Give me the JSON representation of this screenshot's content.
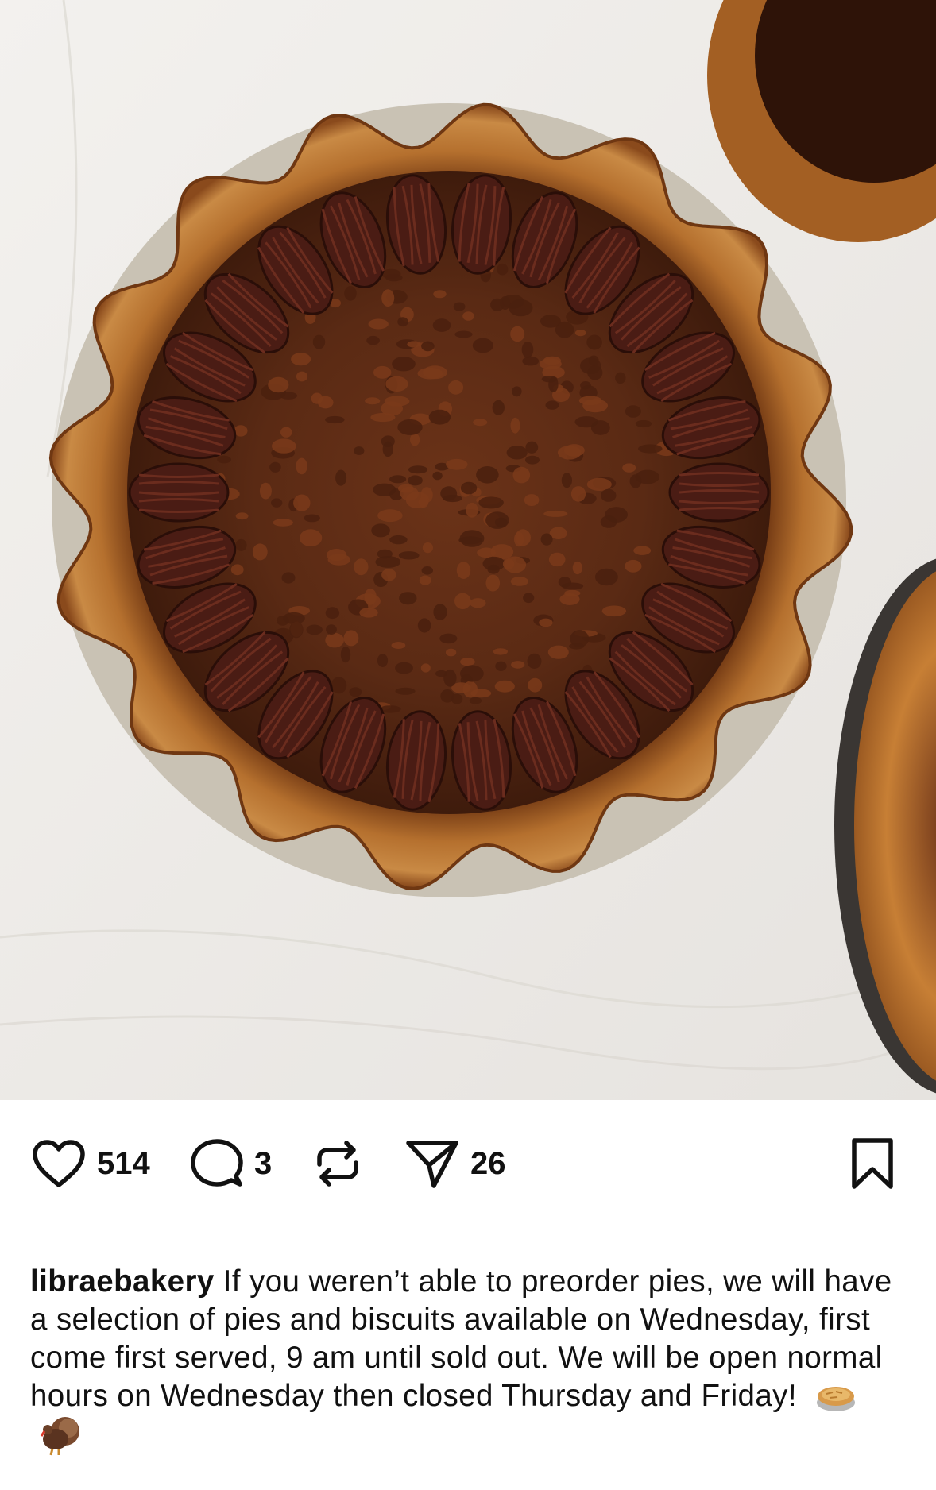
{
  "post": {
    "image": {
      "subject": "pecan-pie-photo",
      "colors": {
        "background": "#efedea",
        "crust": "#b5702e",
        "crust_dark": "#7a3f17",
        "filling": "#5a2a14",
        "pecan": "#4a1c14",
        "tin": "#c9c2b4"
      }
    },
    "actions": {
      "like_icon": "heart-icon",
      "like_count": "514",
      "comment_icon": "comment-icon",
      "comment_count": "3",
      "repost_icon": "repost-icon",
      "share_icon": "send-icon",
      "share_count": "26",
      "save_icon": "bookmark-icon"
    },
    "caption": {
      "username": "libraebakery",
      "text": "If you weren’t able to preorder pies, we will have a selection of pies and biscuits available on Wednesday, first come first served, 9 am until sold out. We will be open normal hours on Wednesday then closed Thursday and Friday!",
      "emojis": [
        "pie-emoji",
        "turkey-emoji"
      ]
    }
  }
}
